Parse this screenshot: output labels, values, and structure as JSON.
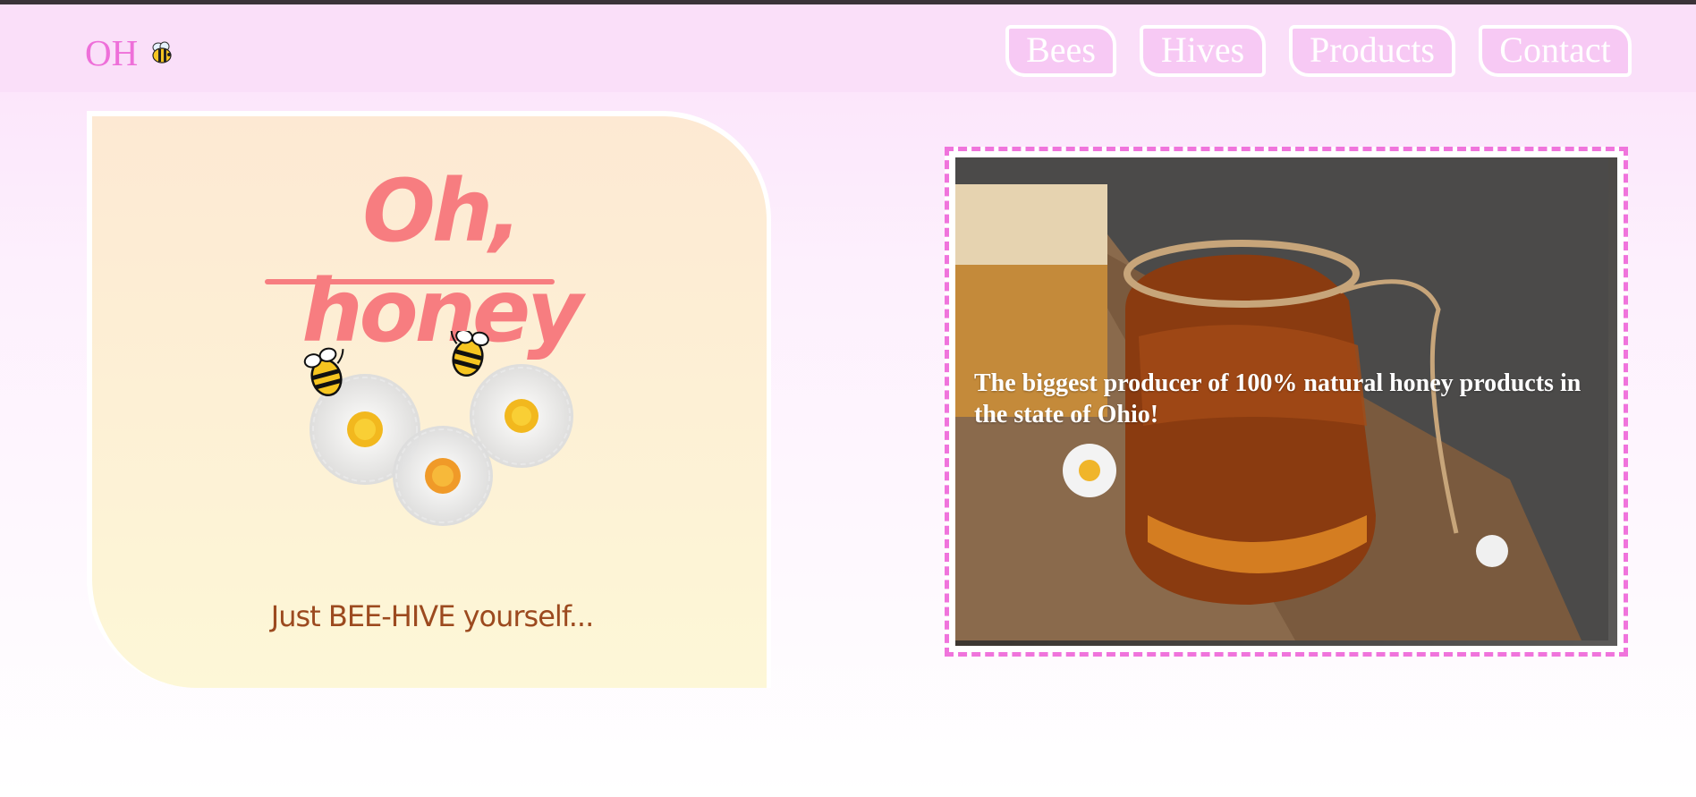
{
  "brand": {
    "logo_text": "OH",
    "logo_icon": "bee-icon",
    "accent": "#ee6fd9"
  },
  "nav": {
    "items": [
      {
        "label": "Bees"
      },
      {
        "label": "Hives"
      },
      {
        "label": "Products"
      },
      {
        "label": "Contact"
      }
    ]
  },
  "hero": {
    "title": "Oh, honey",
    "tagline": "Just BEE-HIVE yourself...",
    "title_color": "#f77d80",
    "tagline_color": "#9c4a1f",
    "illustration": "daisies-with-bees"
  },
  "feature": {
    "caption": "The biggest producer of 100% natural honey products in the state of Ohio!",
    "image": "honey-jar-photo",
    "frame_color": "#f074dc"
  }
}
